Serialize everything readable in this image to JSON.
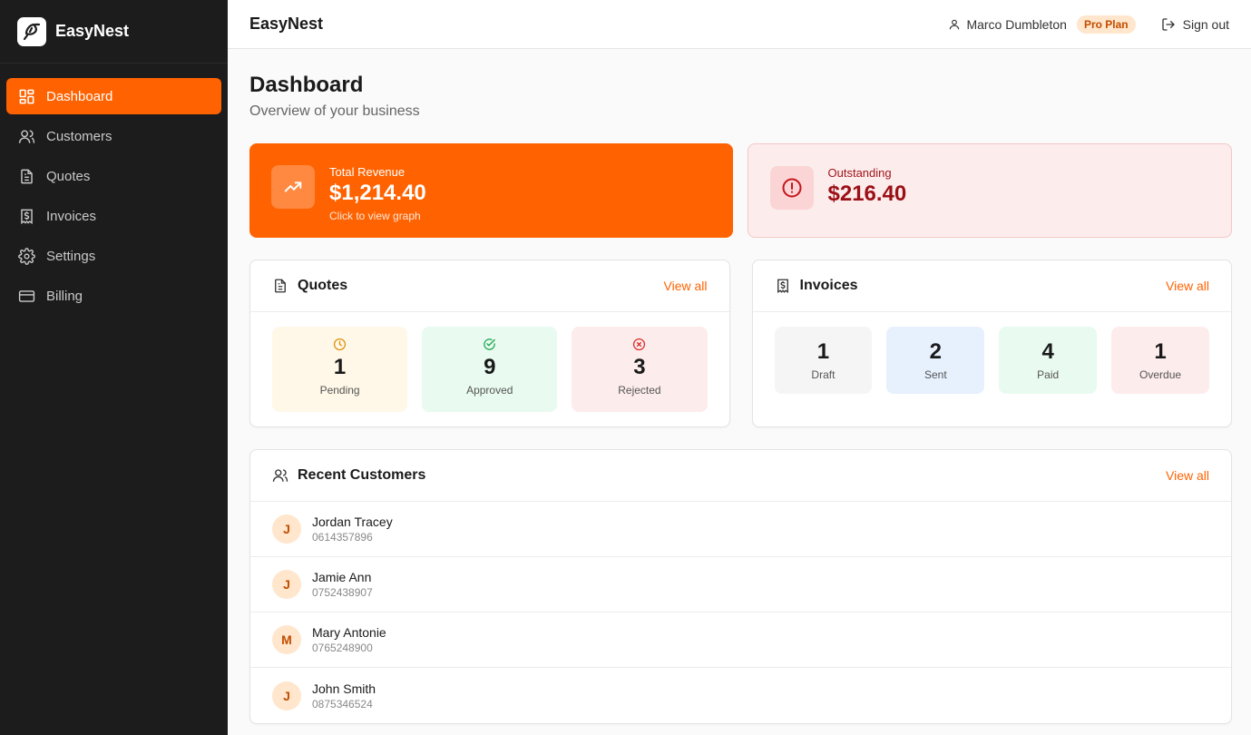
{
  "brand": {
    "name": "EasyNest"
  },
  "sidebar": {
    "items": [
      {
        "label": "Dashboard",
        "icon": "dashboard-icon",
        "active": true
      },
      {
        "label": "Customers",
        "icon": "users-icon"
      },
      {
        "label": "Quotes",
        "icon": "document-icon"
      },
      {
        "label": "Invoices",
        "icon": "invoice-icon"
      },
      {
        "label": "Settings",
        "icon": "gear-icon"
      },
      {
        "label": "Billing",
        "icon": "credit-card-icon"
      }
    ]
  },
  "header": {
    "title": "EasyNest",
    "user_name": "Marco Dumbleton",
    "plan": "Pro Plan",
    "signout_label": "Sign out"
  },
  "page": {
    "title": "Dashboard",
    "subtitle": "Overview of your business"
  },
  "stats": {
    "revenue": {
      "label": "Total Revenue",
      "value": "$1,214.40",
      "hint": "Click to view graph"
    },
    "outstanding": {
      "label": "Outstanding",
      "value": "$216.40"
    }
  },
  "quotes": {
    "title": "Quotes",
    "view_all": "View all",
    "tiles": [
      {
        "value": "1",
        "label": "Pending"
      },
      {
        "value": "9",
        "label": "Approved"
      },
      {
        "value": "3",
        "label": "Rejected"
      }
    ]
  },
  "invoices": {
    "title": "Invoices",
    "view_all": "View all",
    "tiles": [
      {
        "value": "1",
        "label": "Draft"
      },
      {
        "value": "2",
        "label": "Sent"
      },
      {
        "value": "4",
        "label": "Paid"
      },
      {
        "value": "1",
        "label": "Overdue"
      }
    ]
  },
  "customers": {
    "title": "Recent Customers",
    "view_all": "View all",
    "rows": [
      {
        "initial": "J",
        "name": "Jordan Tracey",
        "phone": "0614357896"
      },
      {
        "initial": "J",
        "name": "Jamie Ann",
        "phone": "0752438907"
      },
      {
        "initial": "M",
        "name": "Mary Antonie",
        "phone": "0765248900"
      },
      {
        "initial": "J",
        "name": "John Smith",
        "phone": "0875346524"
      }
    ]
  },
  "colors": {
    "accent": "#ff6200",
    "sidebar_bg": "#1c1c1c",
    "danger": "#9b0f16"
  }
}
